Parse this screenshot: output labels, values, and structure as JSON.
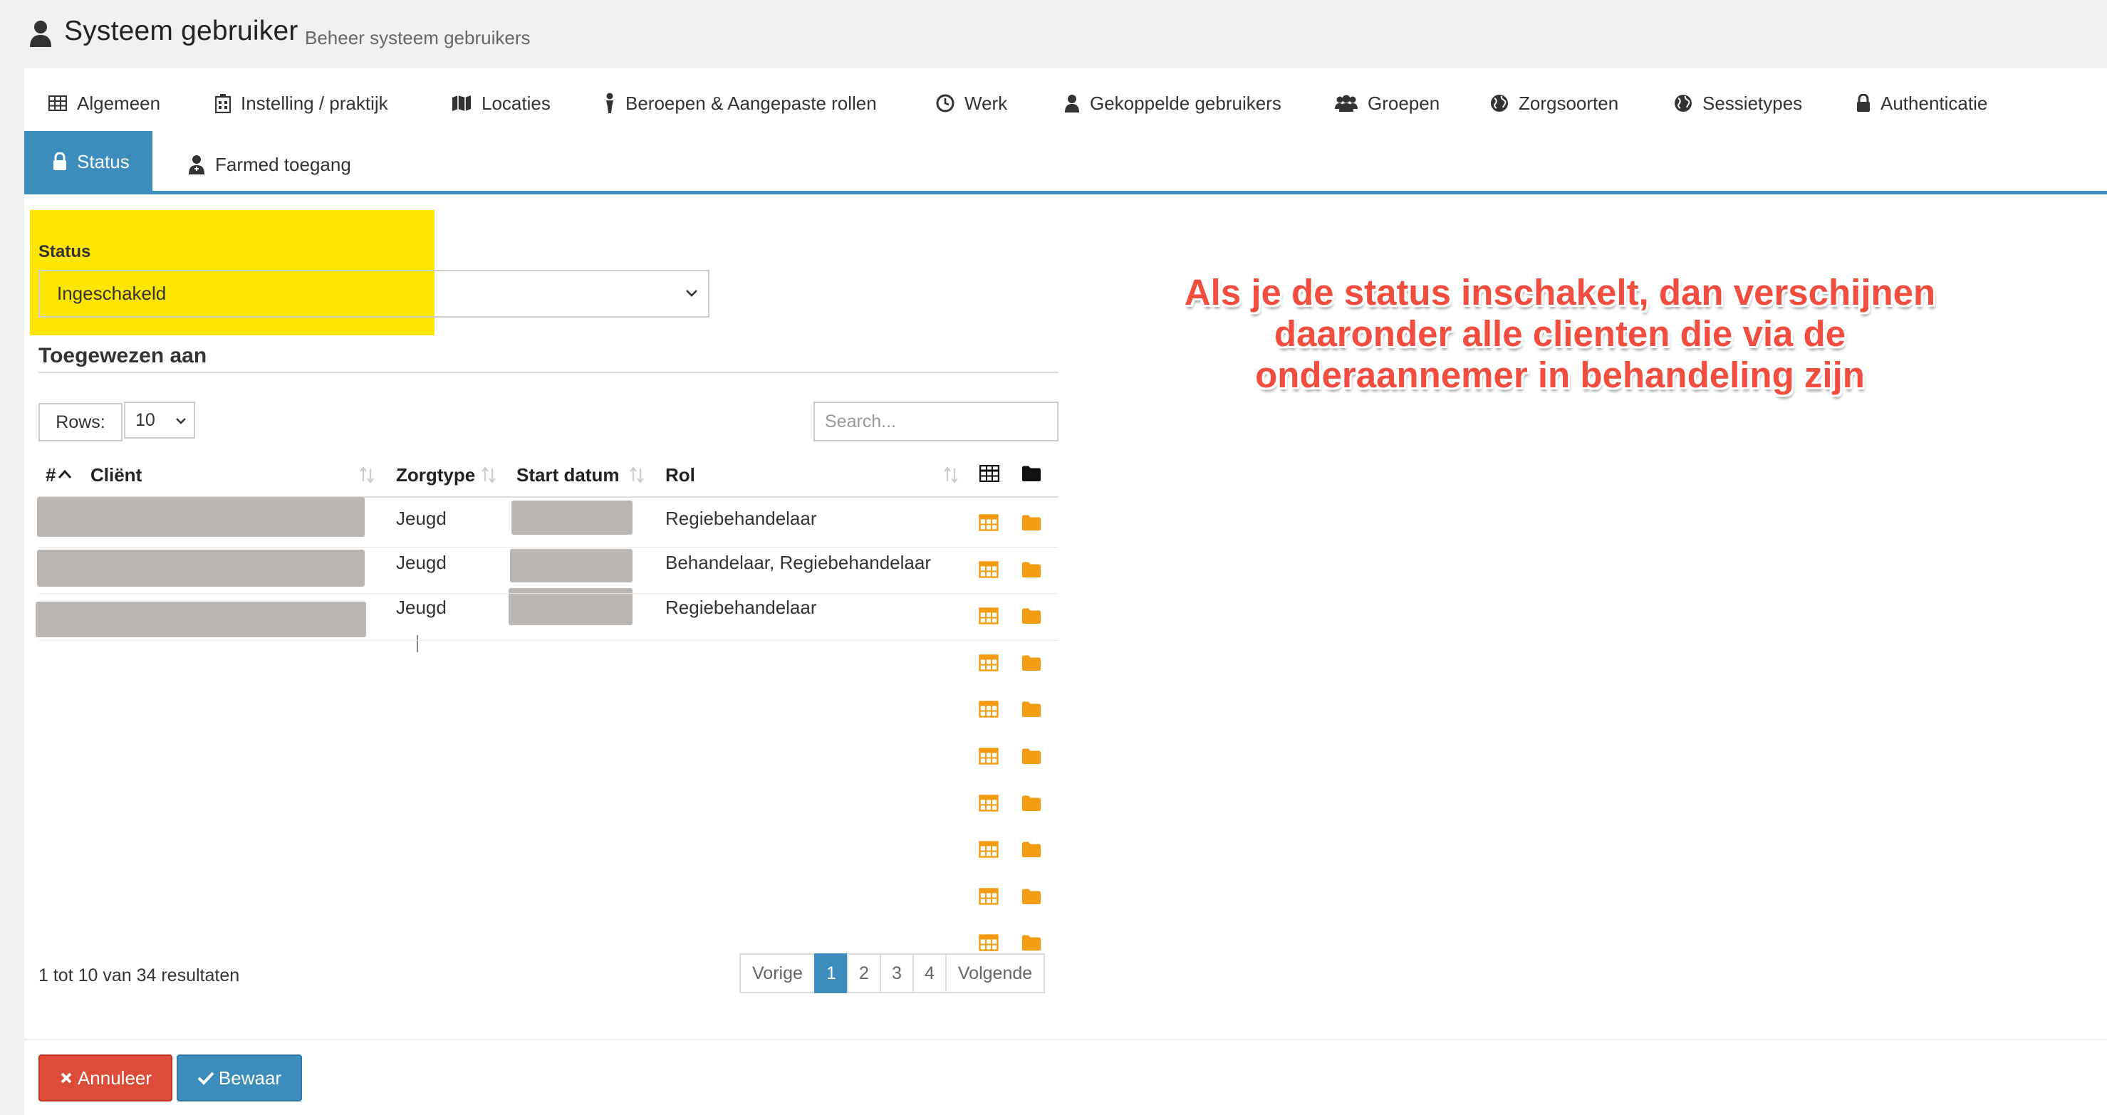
{
  "header": {
    "title": "Systeem gebruiker",
    "subtitle": "Beheer systeem gebruikers"
  },
  "tabs": [
    {
      "label": "Algemeen",
      "icon": "table-icon"
    },
    {
      "label": "Instelling / praktijk",
      "icon": "hospital-icon"
    },
    {
      "label": "Locaties",
      "icon": "map-icon"
    },
    {
      "label": "Beroepen & Aangepaste rollen",
      "icon": "user-tie-icon"
    },
    {
      "label": "Werk",
      "icon": "clock-icon"
    },
    {
      "label": "Gekoppelde gebruikers",
      "icon": "user-icon"
    },
    {
      "label": "Groepen",
      "icon": "users-icon"
    },
    {
      "label": "Zorgsoorten",
      "icon": "globe-icon"
    },
    {
      "label": "Sessietypes",
      "icon": "globe-icon"
    },
    {
      "label": "Authenticatie",
      "icon": "lock-icon"
    },
    {
      "label": "Status",
      "icon": "lock-icon",
      "active": true
    },
    {
      "label": "Farmed toegang",
      "icon": "user-md-icon"
    }
  ],
  "status_form": {
    "label": "Status",
    "value": "Ingeschakeld"
  },
  "assigned": {
    "title": "Toegewezen aan",
    "rows_label": "Rows:",
    "rows_value": "10",
    "search_placeholder": "Search...",
    "columns": {
      "index": "#",
      "client": "Cliënt",
      "care_type": "Zorgtype",
      "start_date": "Start datum",
      "role": "Rol"
    },
    "rows": [
      {
        "care_type": "Jeugd",
        "role": "Regiebehandelaar"
      },
      {
        "care_type": "Jeugd",
        "role": "Behandelaar, Regiebehandelaar"
      },
      {
        "care_type": "Jeugd",
        "role": "Regiebehandelaar"
      },
      {
        "care_type": "",
        "role": ""
      },
      {
        "care_type": "",
        "role": ""
      },
      {
        "care_type": "",
        "role": ""
      },
      {
        "care_type": "",
        "role": ""
      },
      {
        "care_type": "",
        "role": ""
      },
      {
        "care_type": "",
        "role": ""
      },
      {
        "care_type": "",
        "role": ""
      }
    ],
    "result_info": "1 tot 10 van 34 resultaten",
    "pagination": {
      "prev": "Vorige",
      "pages": [
        "1",
        "2",
        "3",
        "4"
      ],
      "current": "1",
      "next": "Volgende"
    }
  },
  "actions": {
    "cancel": "Annuleer",
    "save": "Bewaar"
  },
  "annotation": "Als je de status inschakelt, dan verschijnen daaronder alle clienten die via de onderaannemer in behandeling zijn",
  "colors": {
    "accent": "#3c8dbc",
    "danger": "#dd4b39",
    "highlight": "#ffe600",
    "annotation": "#f24d3f",
    "row_icon": "#f39c12"
  }
}
